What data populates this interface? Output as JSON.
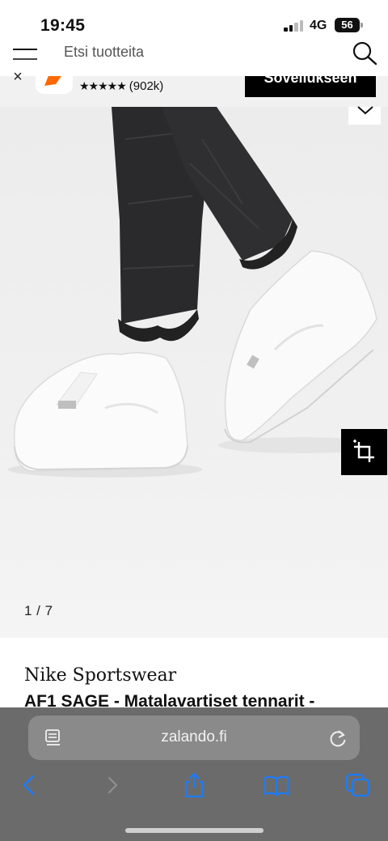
{
  "status_bar": {
    "time": "19:45",
    "network": "4G",
    "battery": "56"
  },
  "search": {
    "placeholder": "Etsi tuotteita"
  },
  "app_banner": {
    "rating_text": "★★★★★",
    "rating_count": "(902k)",
    "open_label": "Sovellukseen"
  },
  "gallery": {
    "pager": "1 / 7"
  },
  "product": {
    "brand": "Nike Sportswear",
    "title": "AF1 SAGE - Matalavartiset tennarit -"
  },
  "browser": {
    "url": "zalando.fi"
  },
  "colors": {
    "accent": "#ff6900",
    "banner_button": "#000000",
    "toolbar": "#6b6b6b",
    "toolbar_icons": "#1a7cff"
  },
  "icons": [
    "menu-icon",
    "search-icon",
    "close-icon",
    "app-logo",
    "chevron-down-icon",
    "crop-icon",
    "page-settings-icon",
    "reload-icon",
    "back-icon",
    "forward-icon",
    "share-icon",
    "bookmarks-icon",
    "tabs-icon"
  ]
}
